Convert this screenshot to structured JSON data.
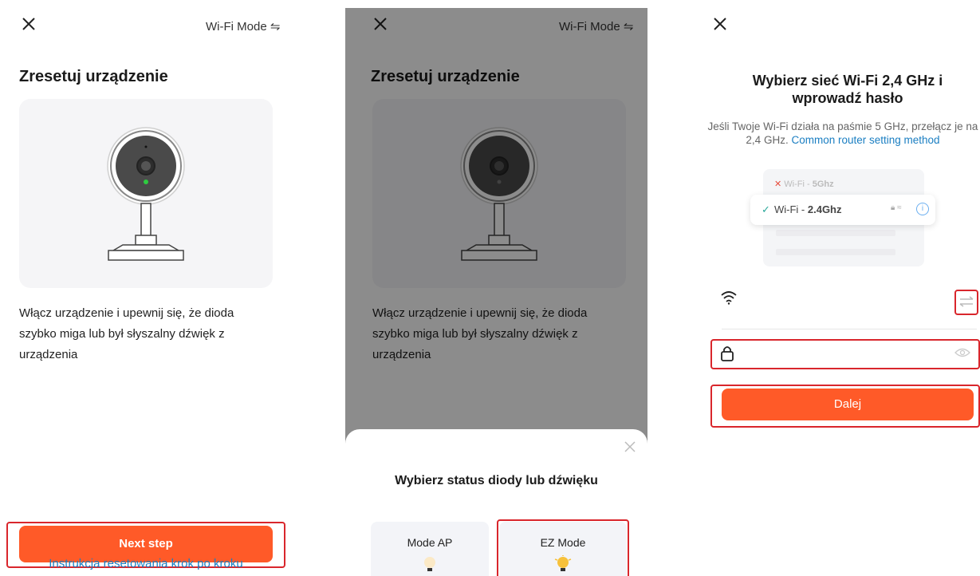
{
  "panel1": {
    "close_icon": "close-icon",
    "mode_label": "Wi-Fi Mode",
    "switch_icon": "⇋",
    "title": "Zresetuj urządzenie",
    "description": "Włącz urządzenie i upewnij się, że dioda szybko miga lub był słyszalny dźwięk z urządzenia",
    "next_label": "Next step",
    "instruction_link": "Instrukcja resetowania krok po kroku",
    "accent": "#ff5a28"
  },
  "panel2": {
    "mode_label": "Wi-Fi Mode",
    "switch_icon": "⇋",
    "title": "Zresetuj urządzenie",
    "description": "Włącz urządzenie i upewnij się, że dioda szybko miga lub był słyszalny dźwięk z urządzenia",
    "sheet_title": "Wybierz status diody lub dźwięku",
    "mode_ap": "Mode AP",
    "mode_ez": "EZ Mode"
  },
  "panel3": {
    "title": "Wybierz sieć Wi-Fi 2,4 GHz i wprowadź hasło",
    "subtitle": "Jeśli Twoje Wi-Fi działa na paśmie 5 GHz, przełącz je na 2,4 GHz.",
    "subtitle_link": "Common router setting method",
    "wifi_5g_prefix": "Wi-Fi - ",
    "wifi_5g": "5Ghz",
    "wifi_24_prefix": "Wi-Fi - ",
    "wifi_24": "2.4Ghz",
    "ssid_value": "",
    "password_value": "",
    "next_label": "Dalej"
  }
}
